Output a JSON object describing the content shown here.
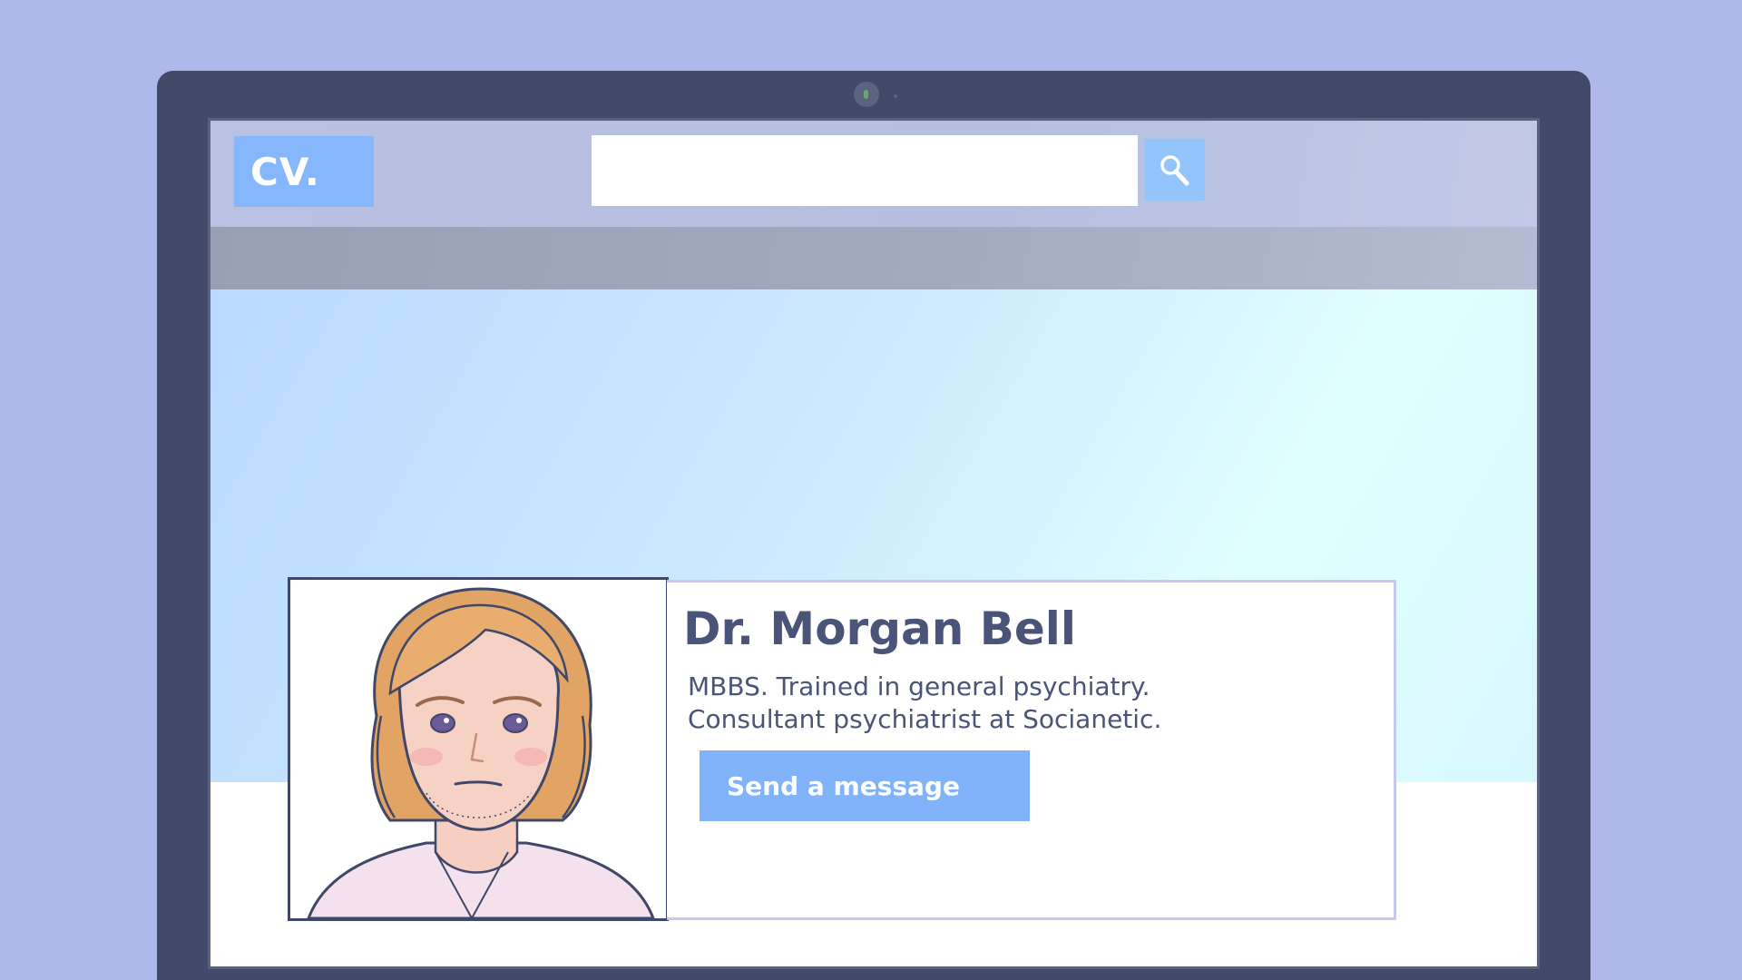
{
  "header": {
    "logo_text": "CV.",
    "search_value": "",
    "search_placeholder": "",
    "search_icon": "magnifier-icon"
  },
  "profile": {
    "name": "Dr. Morgan Bell",
    "description_lines": [
      "MBBS. Trained in general psychiatry.",
      "Consultant psychiatrist at Socianetic."
    ],
    "message_button_label": "Send a message",
    "photo": "portrait-illustration"
  },
  "colors": {
    "background": "#aeb8ea",
    "bezel": "#414a69",
    "accent": "#86b6fb",
    "text": "#4a5478"
  }
}
